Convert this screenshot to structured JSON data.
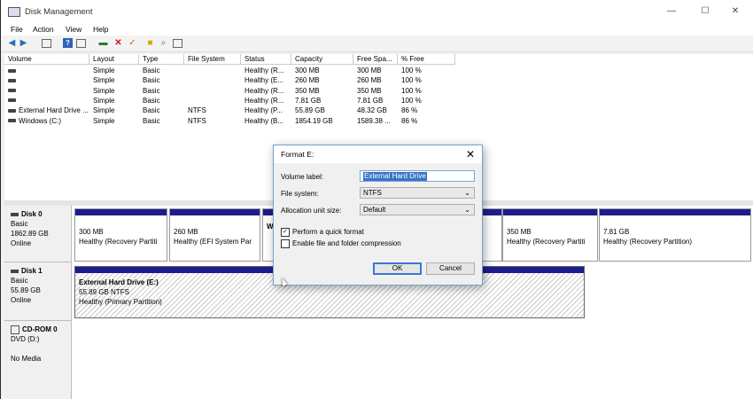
{
  "window": {
    "title": "Disk Management",
    "minimize": "—",
    "maximize": "☐",
    "close": "✕"
  },
  "menu": {
    "file": "File",
    "action": "Action",
    "view": "View",
    "help": "Help"
  },
  "toolbar_icons": [
    "back-icon",
    "forward-icon",
    "console-tree-icon",
    "help-icon",
    "properties-icon",
    "connect-drive-icon",
    "delete-icon",
    "check-icon",
    "folder-icon",
    "search-icon",
    "list-icon"
  ],
  "volume_list": {
    "headers": [
      "Volume",
      "Layout",
      "Type",
      "File System",
      "Status",
      "Capacity",
      "Free Spa...",
      "% Free"
    ],
    "rows": [
      [
        "",
        "Simple",
        "Basic",
        "",
        "Healthy (R...",
        "300 MB",
        "300 MB",
        "100 %"
      ],
      [
        "",
        "Simple",
        "Basic",
        "",
        "Healthy (E...",
        "260 MB",
        "260 MB",
        "100 %"
      ],
      [
        "",
        "Simple",
        "Basic",
        "",
        "Healthy (R...",
        "350 MB",
        "350 MB",
        "100 %"
      ],
      [
        "",
        "Simple",
        "Basic",
        "",
        "Healthy (R...",
        "7.81 GB",
        "7.81 GB",
        "100 %"
      ],
      [
        "External Hard Drive ...",
        "Simple",
        "Basic",
        "NTFS",
        "Healthy (P...",
        "55.89 GB",
        "48.32 GB",
        "86 %"
      ],
      [
        "Windows (C:)",
        "Simple",
        "Basic",
        "NTFS",
        "Healthy (B...",
        "1854.19 GB",
        "1589.38 ...",
        "86 %"
      ]
    ]
  },
  "disks": [
    {
      "name": "Disk 0",
      "type": "Basic",
      "size": "1862.89 GB",
      "status": "Online",
      "partitions": [
        {
          "size": "300 MB",
          "desc": "Healthy (Recovery Partiti"
        },
        {
          "size": "260 MB",
          "desc": "Healthy (EFI System Par"
        },
        {
          "size": "",
          "desc": "W"
        },
        {
          "size": "350 MB",
          "desc": "Healthy (Recovery Partiti"
        },
        {
          "size": "7.81 GB",
          "desc": "Healthy (Recovery Partition)"
        }
      ]
    },
    {
      "name": "Disk 1",
      "type": "Basic",
      "size": "55.89 GB",
      "status": "Online",
      "partitions": [
        {
          "title": "External Hard Drive  (E:)",
          "size": "55.89 GB NTFS",
          "desc": "Healthy (Primary Partition)"
        }
      ]
    },
    {
      "name": "CD-ROM 0",
      "type": "DVD (D:)",
      "status": "No Media"
    }
  ],
  "dialog": {
    "title": "Format E:",
    "close": "✕",
    "volume_label_caption": "Volume label:",
    "volume_label_value": "External Hard Drive",
    "file_system_caption": "File system:",
    "file_system_value": "NTFS",
    "alloc_caption": "Allocation unit size:",
    "alloc_value": "Default",
    "quick_format": {
      "label": "Perform a quick format",
      "checked": true
    },
    "compression": {
      "label": "Enable file and folder compression",
      "checked": false
    },
    "ok": "OK",
    "cancel": "Cancel"
  },
  "colors": {
    "primary_partition_bar": "#1c1c8e",
    "selection": "#3a73c6"
  }
}
